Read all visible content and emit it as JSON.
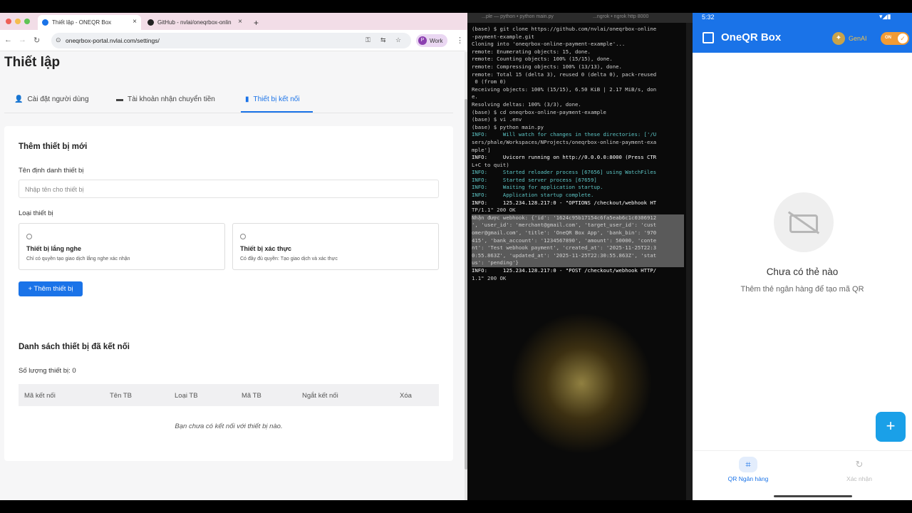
{
  "browser": {
    "tabs": [
      {
        "title": "Thiết lập - ONEQR Box",
        "active": true
      },
      {
        "title": "GitHub - nvlai/oneqrbox-onlin",
        "active": false
      }
    ],
    "new_tab_symbol": "+",
    "url": "oneqrbox-portal.nvlai.com/settings/",
    "profile_label": "Work",
    "profile_initial": "P"
  },
  "settings": {
    "page_title": "Thiết lập",
    "tabs": [
      {
        "label": "Cài đặt người dùng",
        "icon": "user-icon"
      },
      {
        "label": "Tài khoản nhận chuyển tiền",
        "icon": "card-icon"
      },
      {
        "label": "Thiết bị kết nối",
        "icon": "device-icon",
        "active": true
      }
    ],
    "add_section": {
      "title": "Thêm thiết bị mới",
      "name_label": "Tên định danh thiết bị",
      "name_placeholder": "Nhập tên cho thiết bị",
      "type_label": "Loại thiết bị",
      "options": [
        {
          "title": "Thiết bị lắng nghe",
          "desc": "Chỉ có quyền tạo giao dịch lắng nghe xác nhận"
        },
        {
          "title": "Thiết bị xác thực",
          "desc": "Có đầy đủ quyền: Tạo giao dịch và xác thực"
        }
      ],
      "add_button": "+ Thêm thiết bị"
    },
    "list_section": {
      "title": "Danh sách thiết bị đã kết nối",
      "count_label": "Số lượng thiết bị: 0",
      "columns": [
        "Mã kết nối",
        "Tên TB",
        "Loại TB",
        "Mã TB",
        "Ngắt kết nối",
        "Xóa"
      ],
      "empty_text": "Bạn chưa có kết nối với thiết bị nào."
    }
  },
  "terminal": {
    "tabs": [
      "...ple — python • python main.py",
      "...ngrok • ngrok http 8000"
    ],
    "lines": [
      "(base) $ git clone https://github.com/nvlai/oneqrbox-online",
      "-payment-example.git",
      "Cloning into 'oneqrbox-online-payment-example'...",
      "remote: Enumerating objects: 15, done.",
      "remote: Counting objects: 100% (15/15), done.",
      "remote: Compressing objects: 100% (13/13), done.",
      "remote: Total 15 (delta 3), reused 0 (delta 0), pack-reused",
      " 0 (from 0)",
      "Receiving objects: 100% (15/15), 6.50 KiB | 2.17 MiB/s, don",
      "e.",
      "Resolving deltas: 100% (3/3), done.",
      "(base) $ cd oneqrbox-online-payment-example",
      "(base) $ vi .env",
      "(base) $ python main.py",
      "INFO:     Will watch for changes in these directories: ['/U",
      "sers/phale/Workspaces/NProjects/oneqrbox-online-payment-exa",
      "mple']",
      "INFO:     Uvicorn running on http://0.0.0.0:8000 (Press CTR",
      "L+C to quit)",
      "INFO:     Started reloader process [67656] using WatchFiles",
      "INFO:     Started server process [67659]",
      "INFO:     Waiting for application startup.",
      "INFO:     Application startup complete.",
      "INFO:     125.234.128.217:0 - \"OPTIONS /checkout/webhook HT",
      "TP/1.1\" 200 OK",
      "Nhận được webhook: {'id': '1624c95b17154c6fa5eab6c1c0306912",
      "', 'user_id': 'merchant@gmail.com', 'target_user_id': 'cust",
      "omer@gmail.com', 'title': 'OneQR Box App', 'bank_bin': '970",
      "415', 'bank_account': '1234567890', 'amount': 50000, 'conte",
      "nt': 'Test webhook payment', 'created_at': '2025-11-25T22:3",
      "0:55.863Z', 'updated_at': '2025-11-25T22:30:55.863Z', 'stat",
      "us': 'pending'}",
      "INFO:     125.234.128.217:0 - \"POST /checkout/webhook HTTP/",
      "1.1\" 200 OK"
    ]
  },
  "phone": {
    "time": "5:32",
    "app_title": "OneQR Box",
    "genai_label": "GenAI",
    "toggle_label": "ON",
    "empty_title": "Chưa có thẻ nào",
    "empty_subtitle": "Thêm thẻ ngân hàng để tạo mã QR",
    "fab_symbol": "+",
    "nav": [
      {
        "label": "QR Ngân hàng",
        "active": true
      },
      {
        "label": "Xác nhận",
        "active": false
      }
    ]
  },
  "colors": {
    "accent": "#1a73e8",
    "terminal_bg": "#0a0a0a",
    "toggle": "#f29b34"
  }
}
